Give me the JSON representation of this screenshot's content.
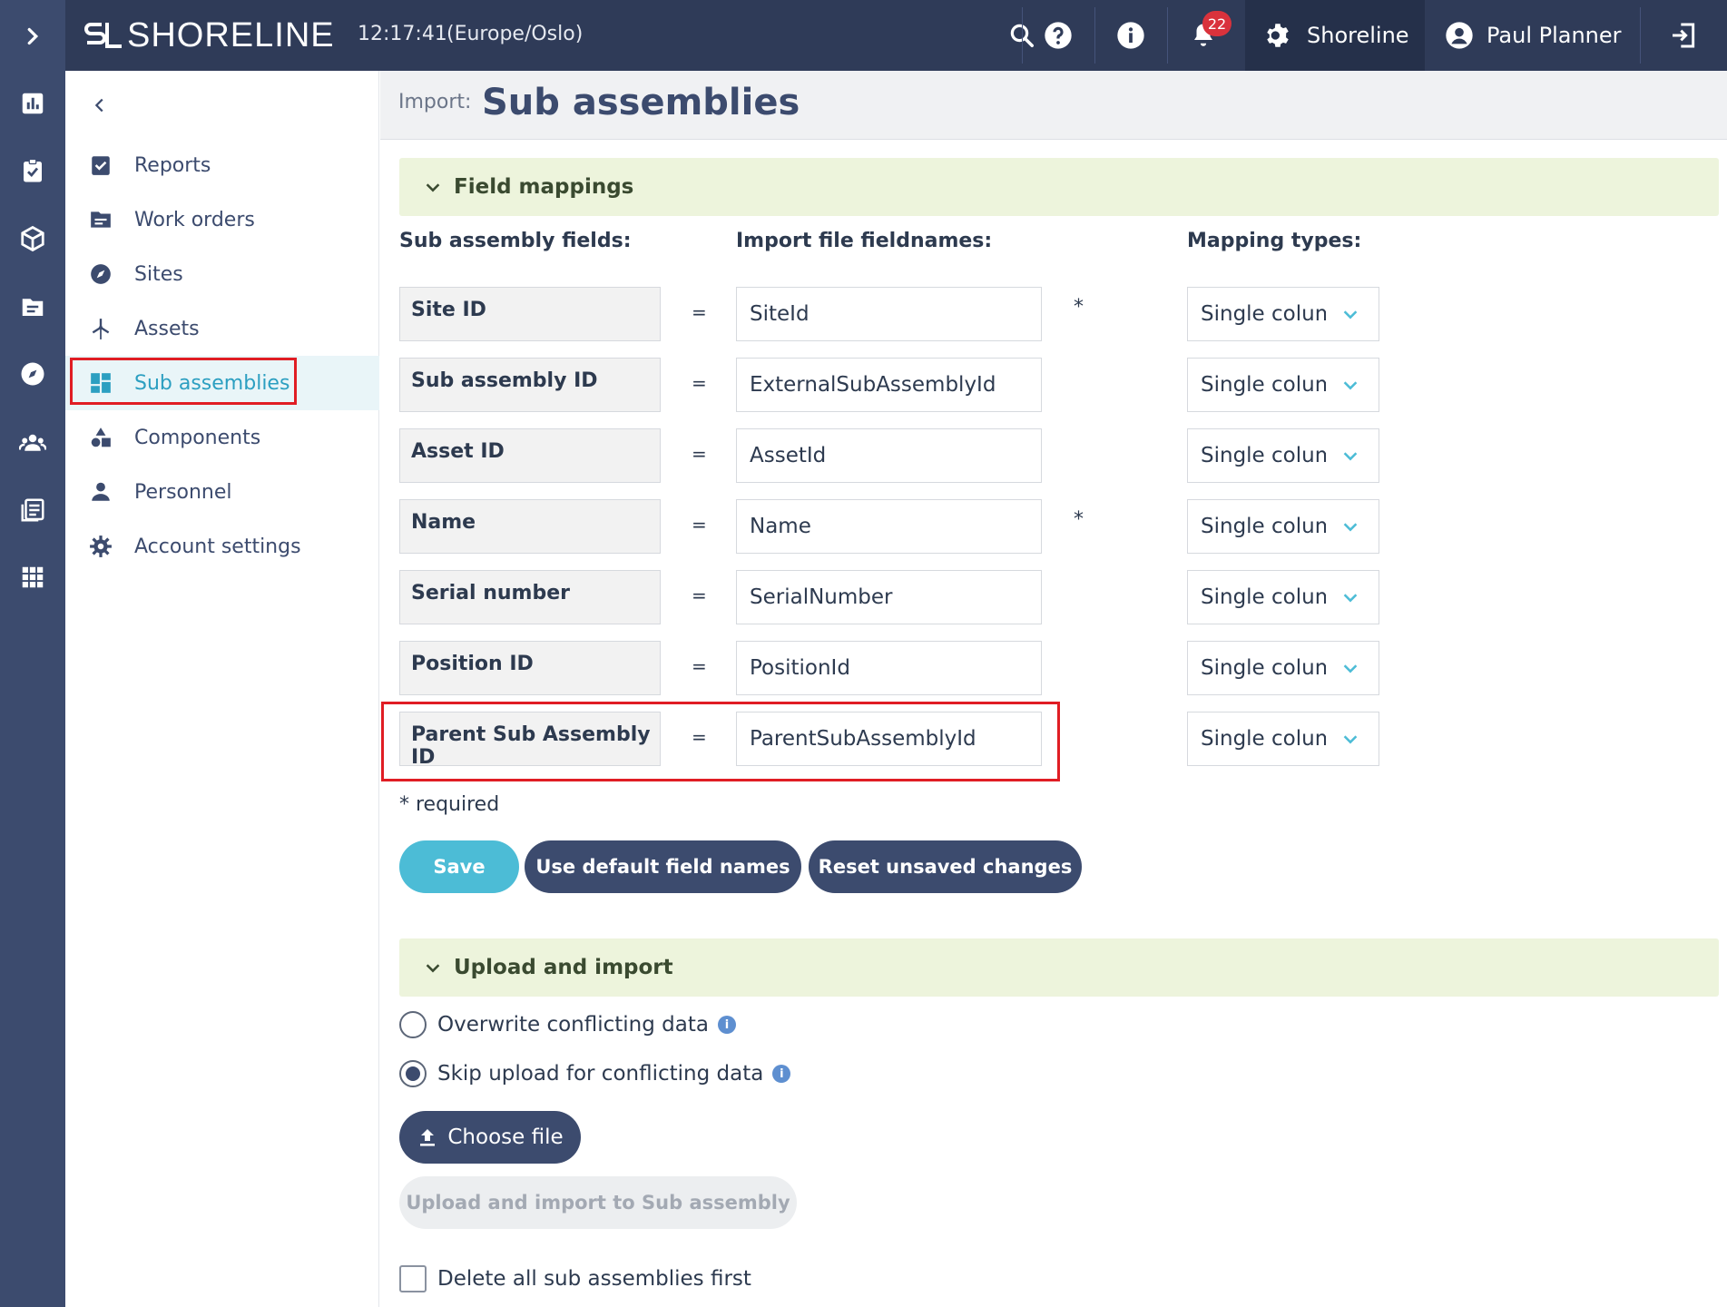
{
  "app": {
    "brand": "SHORELINE",
    "clock": "12:17:41",
    "timezone": "(Europe/Oslo)",
    "notifications_count": "22",
    "tenant": "Shoreline",
    "user": "Paul Planner"
  },
  "rail_icons": [
    "expand-icon",
    "dashboard-icon",
    "checklist-icon",
    "package-icon",
    "folder-icon",
    "compass-icon",
    "team-icon",
    "reports-icon",
    "apps-grid-icon"
  ],
  "sidenav": {
    "items": [
      {
        "label": "Reports",
        "icon": "checklist-icon"
      },
      {
        "label": "Work orders",
        "icon": "folder-icon"
      },
      {
        "label": "Sites",
        "icon": "compass-icon"
      },
      {
        "label": "Assets",
        "icon": "wind-turbine-icon"
      },
      {
        "label": "Sub assemblies",
        "icon": "dashboard-grid-icon",
        "active": true
      },
      {
        "label": "Components",
        "icon": "shapes-icon"
      },
      {
        "label": "Personnel",
        "icon": "person-icon"
      },
      {
        "label": "Account settings",
        "icon": "gear-icon"
      }
    ]
  },
  "page": {
    "prefix": "Import:",
    "title": "Sub assemblies"
  },
  "field_mappings": {
    "section_label": "Field mappings",
    "col_fields": "Sub assembly fields:",
    "col_filenames": "Import file fieldnames:",
    "col_types": "Mapping types:",
    "equals": "=",
    "required_marker": "*",
    "rows": [
      {
        "field": "Site ID",
        "filename": "SiteId",
        "required": true,
        "type": "Single column"
      },
      {
        "field": "Sub assembly ID",
        "filename": "ExternalSubAssemblyId",
        "required": false,
        "type": "Single column"
      },
      {
        "field": "Asset ID",
        "filename": "AssetId",
        "required": false,
        "type": "Single column"
      },
      {
        "field": "Name",
        "filename": "Name",
        "required": true,
        "type": "Single column"
      },
      {
        "field": "Serial number",
        "filename": "SerialNumber",
        "required": false,
        "type": "Single column"
      },
      {
        "field": "Position ID",
        "filename": "PositionId",
        "required": false,
        "type": "Single column"
      },
      {
        "field": "Parent Sub Assembly ID",
        "filename": "ParentSubAssemblyId",
        "required": false,
        "type": "Single column"
      }
    ],
    "required_note": "* required",
    "buttons": {
      "save": "Save",
      "defaults": "Use default field names",
      "reset": "Reset unsaved changes"
    }
  },
  "upload": {
    "section_label": "Upload and import",
    "option_overwrite": "Overwrite conflicting data",
    "option_skip": "Skip upload for conflicting data",
    "selected_option": "skip",
    "choose_file": "Choose file",
    "upload_button": "Upload and import to Sub assembly",
    "delete_first": "Delete all sub assemblies first",
    "delete_first_checked": false
  },
  "colors": {
    "rail": "#3c4b6e",
    "topbar": "#2f3b58",
    "accent": "#4cbcd6",
    "primary_button": "#3c4b6e",
    "highlight": "#e01d24",
    "section_bar": "#edf4dc"
  }
}
